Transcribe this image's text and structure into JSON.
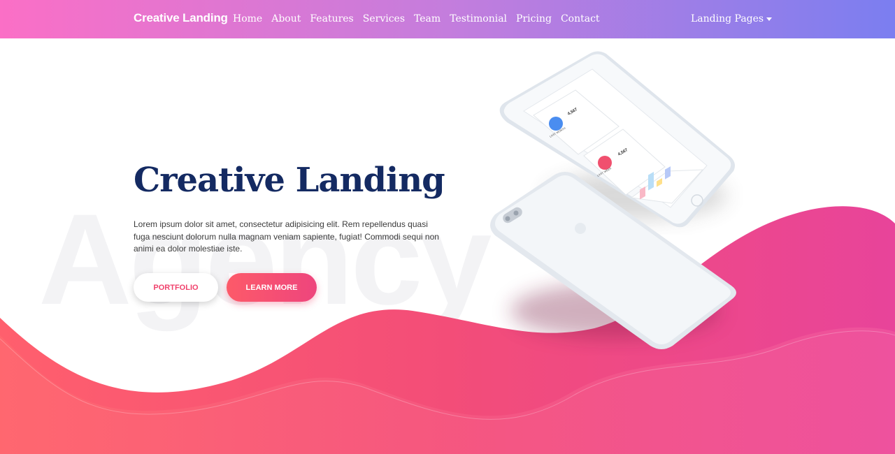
{
  "navbar": {
    "brand": "Creative Landing",
    "links": [
      "Home",
      "About",
      "Features",
      "Services",
      "Team",
      "Testimonial",
      "Pricing",
      "Contact"
    ],
    "dropdown_label": "Landing Pages"
  },
  "hero": {
    "watermark": "Agency",
    "title": "Creative Landing",
    "text": "Lorem ipsum dolor sit amet, consectetur adipisicing elit. Rem repellendus quasi fuga nesciunt dolorum nulla magnam veniam sapiente, fugiat! Commodi sequi non animi ea dolor molestiae iste.",
    "portfolio_label": "PORTFOLIO",
    "learn_more_label": "LEARN MORE"
  },
  "phone_screen": {
    "card1_value": "4,567",
    "card1_label": "LAST MONTH",
    "card2_value": "4,567",
    "card2_label": "LAST WEEK"
  },
  "colors": {
    "nav_start": "#fb6fc6",
    "nav_end": "#7b7ef0",
    "title": "#142a62",
    "accent": "#f0436d",
    "wave_start": "#ff5f6d",
    "wave_end": "#e8449a"
  }
}
